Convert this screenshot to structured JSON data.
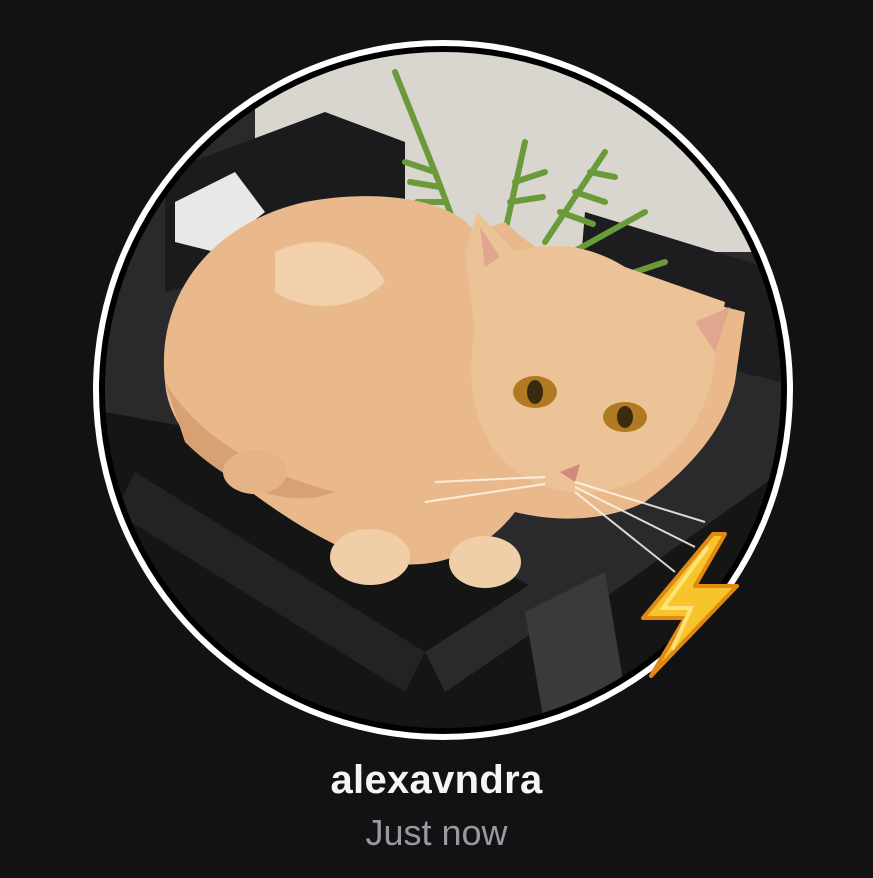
{
  "profile": {
    "username": "alexavndra",
    "timestamp": "Just now",
    "avatar_icon": "avatar-photo",
    "badge_icon": "lightning-bolt-icon",
    "ring_color": "#ffffff",
    "background_color": "#121214",
    "badge_color": "#f7c52b"
  }
}
